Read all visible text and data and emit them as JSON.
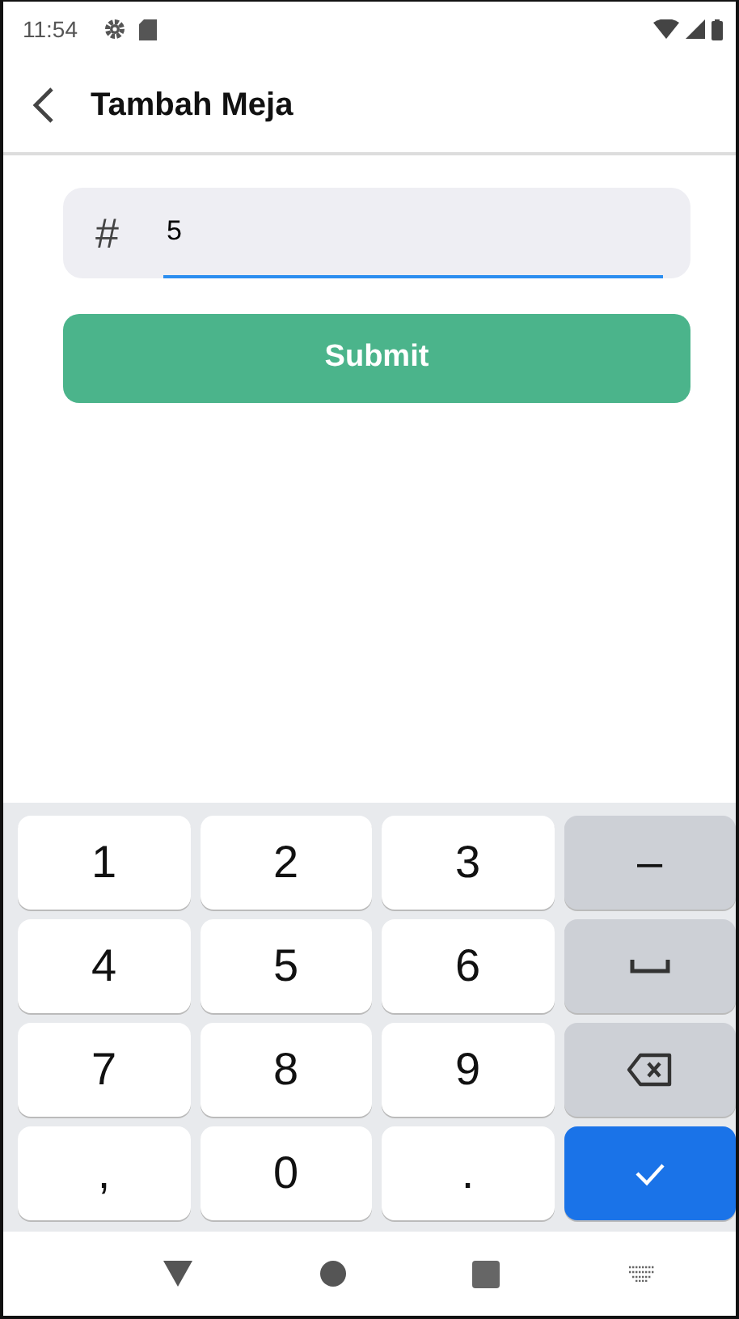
{
  "status_bar": {
    "time": "11:54"
  },
  "app_bar": {
    "title": "Tambah Meja"
  },
  "form": {
    "prefix": "#",
    "value": "5",
    "focused": true,
    "submit": "Submit"
  },
  "keyboard": {
    "keys": [
      {
        "kind": "char",
        "label": "1"
      },
      {
        "kind": "char",
        "label": "2"
      },
      {
        "kind": "char",
        "label": "3"
      },
      {
        "kind": "symbol",
        "label": "–"
      },
      {
        "kind": "char",
        "label": "4"
      },
      {
        "kind": "char",
        "label": "5"
      },
      {
        "kind": "char",
        "label": "6"
      },
      {
        "kind": "space"
      },
      {
        "kind": "char",
        "label": "7"
      },
      {
        "kind": "char",
        "label": "8"
      },
      {
        "kind": "char",
        "label": "9"
      },
      {
        "kind": "backspace"
      },
      {
        "kind": "char",
        "label": ","
      },
      {
        "kind": "char",
        "label": "0"
      },
      {
        "kind": "char",
        "label": "."
      },
      {
        "kind": "enter"
      }
    ]
  }
}
